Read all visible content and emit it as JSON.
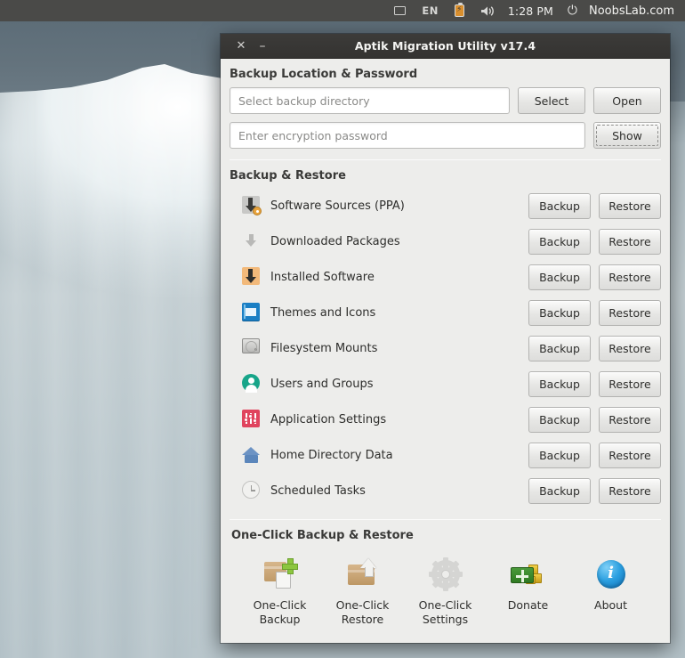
{
  "panel": {
    "tray_icons": [
      "display-icon",
      "keyboard-layout",
      "battery-icon",
      "volume-icon"
    ],
    "keyboard_layout": "EN",
    "clock": "1:28 PM",
    "power_icon": "⏻",
    "username": "NoobsLab.com"
  },
  "window": {
    "title": "Aptik Migration Utility v17.4",
    "close_glyph": "✕",
    "minimize_glyph": "–"
  },
  "backup_location": {
    "heading": "Backup Location & Password",
    "directory_placeholder": "Select backup directory",
    "directory_value": "",
    "select_label": "Select",
    "open_label": "Open",
    "password_placeholder": "Enter encryption password",
    "password_value": "",
    "show_label": "Show"
  },
  "backup_restore": {
    "heading": "Backup & Restore",
    "backup_label": "Backup",
    "restore_label": "Restore",
    "items": [
      {
        "label": "Software Sources (PPA)",
        "icon": "ppa-download-icon"
      },
      {
        "label": "Downloaded Packages",
        "icon": "download-arrow-icon"
      },
      {
        "label": "Installed Software",
        "icon": "install-package-icon"
      },
      {
        "label": "Themes and Icons",
        "icon": "theme-window-icon"
      },
      {
        "label": "Filesystem Mounts",
        "icon": "harddisk-icon"
      },
      {
        "label": "Users and Groups",
        "icon": "user-icon"
      },
      {
        "label": "Application Settings",
        "icon": "sliders-icon"
      },
      {
        "label": "Home Directory Data",
        "icon": "home-icon"
      },
      {
        "label": "Scheduled Tasks",
        "icon": "clock-icon"
      }
    ]
  },
  "one_click": {
    "heading": "One-Click Backup & Restore",
    "actions": [
      {
        "label": "One-Click\nBackup",
        "icon": "box-plus-icon"
      },
      {
        "label": "One-Click\nRestore",
        "icon": "box-uparrow-icon"
      },
      {
        "label": "One-Click\nSettings",
        "icon": "gear-icon"
      },
      {
        "label": "Donate",
        "icon": "money-icon"
      },
      {
        "label": "About",
        "icon": "info-icon"
      }
    ]
  },
  "colors": {
    "window_bg": "#ededeb",
    "titlebar": "#3a3937",
    "panel": "#4a4a48",
    "accent_orange": "#e8a33d",
    "accent_blue": "#2b9fe0"
  }
}
